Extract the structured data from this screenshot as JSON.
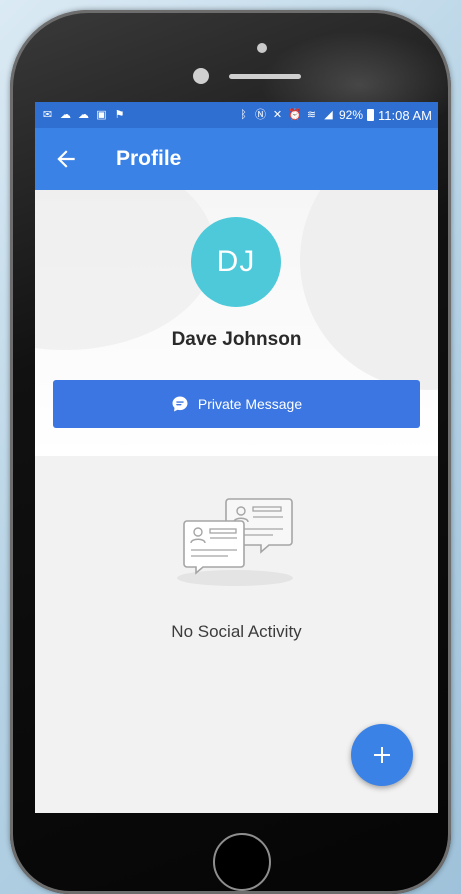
{
  "status_bar": {
    "left_icons": [
      "mail-icon",
      "weather-icon",
      "cloud-icon",
      "image-icon",
      "flag-icon"
    ],
    "right_icons": [
      "bluetooth-icon",
      "nfc-icon",
      "mute-icon",
      "alarm-icon",
      "wifi-icon",
      "lte-icon",
      "signal-icon"
    ],
    "battery": "92%",
    "time": "11:08 AM"
  },
  "header": {
    "back_icon": "arrow-left-icon",
    "title": "Profile",
    "color": "#3b82e6"
  },
  "profile": {
    "initials": "DJ",
    "name": "Dave Johnson",
    "avatar_color": "#4dc9d9",
    "private_message_label": "Private Message",
    "private_message_icon": "chat-bubble-icon"
  },
  "activity": {
    "empty_icon": "contact-cards-icon",
    "empty_text": "No Social Activity"
  },
  "fab": {
    "icon": "plus-icon",
    "color": "#3b82e6"
  }
}
